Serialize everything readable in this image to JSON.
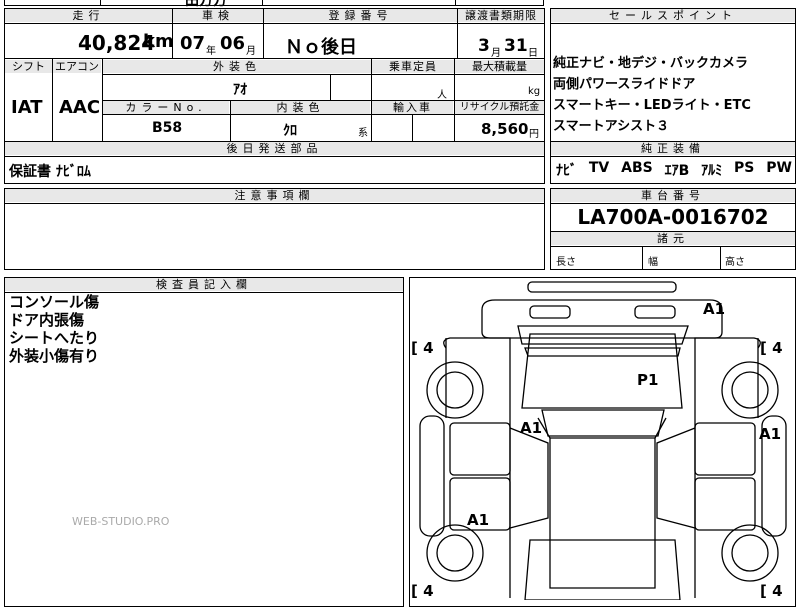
{
  "top_strip": {
    "partial_text": "田方方"
  },
  "headers": {
    "mileage": "走行",
    "inspection": "車検",
    "registration": "登録番号",
    "transfer_deadline": "譲渡書類期限",
    "shift": "シフト",
    "aircon": "エアコン",
    "exterior_color": "外装色",
    "capacity": "乗車定員",
    "max_load": "最大積載量",
    "color_no": "カラーNo.",
    "interior_color": "内装色",
    "import": "輸入車",
    "recycle": "リサイクル預託金",
    "later_parts": "後日発送部品",
    "notes": "注意事項欄",
    "inspector": "検査員記入欄",
    "sales_points": "セールスポイント",
    "equipment": "純正装備",
    "chassis": "車台番号",
    "dimensions": "諸元"
  },
  "values": {
    "mileage": "40,824",
    "mileage_unit": "km",
    "inspection_year": "07",
    "year_unit": "年",
    "inspection_month": "06",
    "month_unit": "月",
    "registration": "Ｎｏ後日",
    "transfer_month": "3",
    "transfer_month_unit": "月",
    "transfer_day": "31",
    "transfer_day_unit": "日",
    "shift": "IAT",
    "aircon": "AAC",
    "exterior_color": "ｱｵ",
    "capacity_unit": "人",
    "load_unit": "kg",
    "color_no": "B58",
    "interior_color": "ｸﾛ",
    "interior_suffix": "系",
    "recycle": "8,560",
    "recycle_unit": "円",
    "later_parts": "保証書 ﾅﾋﾞﾛﾑ",
    "chassis": "LA700A-0016702",
    "length_label": "長さ",
    "width_label": "幅",
    "height_label": "高さ"
  },
  "sales_points": [
    "純正ナビ・地デジ・バックカメラ",
    "両側パワースライドドア",
    "スマートキー・LEDライト・ETC",
    "スマートアシスト３"
  ],
  "equipment": [
    "ﾅﾋﾞ",
    "TV",
    "ABS",
    "ｴｱB",
    "ｱﾙﾐ",
    "PS",
    "PW"
  ],
  "inspector_notes": [
    "コンソール傷",
    "ドア内張傷",
    "シートへたり",
    "外装小傷有り"
  ],
  "watermark": "WEB-STUDIO.PRO",
  "diagram": {
    "marks": [
      {
        "id": "a1-top",
        "text": "A1"
      },
      {
        "id": "p1",
        "text": "P1"
      },
      {
        "id": "a1-center",
        "text": "A1"
      },
      {
        "id": "a1-right",
        "text": "A1"
      },
      {
        "id": "a1-left",
        "text": "A1"
      }
    ],
    "tires": [
      {
        "id": "tl",
        "text": "4"
      },
      {
        "id": "tr",
        "text": "4"
      },
      {
        "id": "bl",
        "text": "4"
      },
      {
        "id": "br",
        "text": "4"
      }
    ]
  }
}
